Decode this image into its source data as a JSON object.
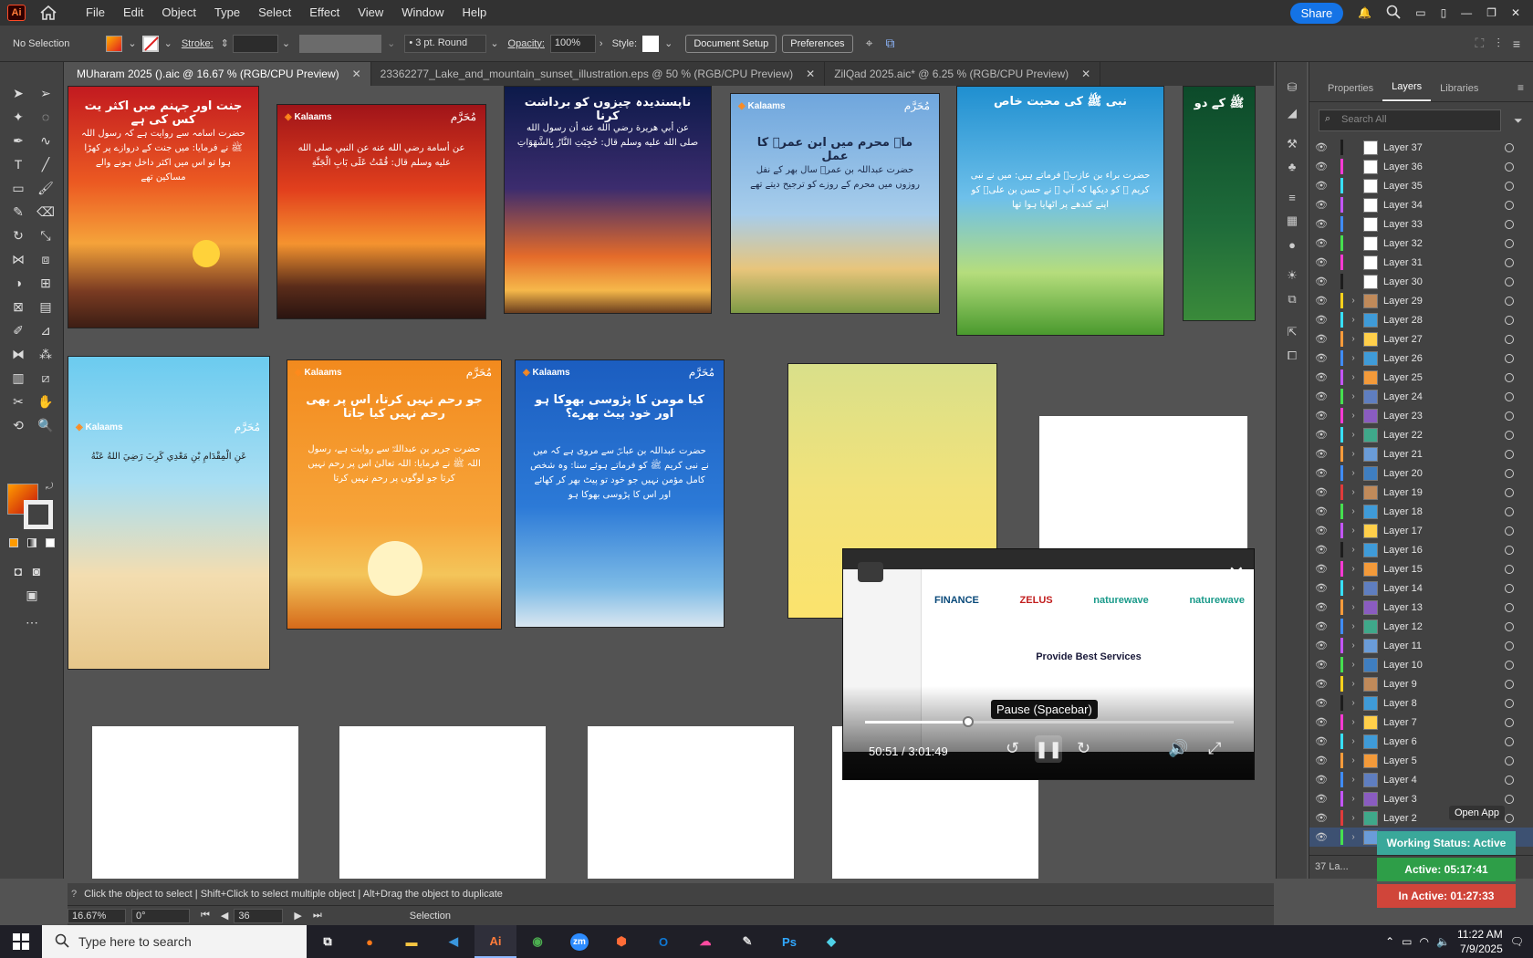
{
  "app": {
    "logo": "Ai",
    "menu": [
      "File",
      "Edit",
      "Object",
      "Type",
      "Select",
      "Effect",
      "View",
      "Window",
      "Help"
    ],
    "share_label": "Share"
  },
  "controlbar": {
    "selection": "No Selection",
    "stroke_label": "Stroke:",
    "brush": "3 pt. Round",
    "opacity_label": "Opacity:",
    "opacity_value": "100%",
    "style_label": "Style:",
    "document_setup": "Document Setup",
    "preferences": "Preferences"
  },
  "tabs": [
    {
      "label": "MUharam 2025 ().aic @ 16.67 % (RGB/CPU Preview)"
    },
    {
      "label": "23362277_Lake_and_mountain_sunset_illustration.eps @ 50 % (RGB/CPU Preview)"
    },
    {
      "label": "ZilQad 2025.aic* @ 6.25 % (RGB/CPU Preview)"
    }
  ],
  "artboards": {
    "a1_title": "جنت اور جہنم میں اکثر یت کس کی ہے",
    "a1_body": "حضرت اسامہ سے روایت ہے کہ رسول اللہ ﷺ نے فرمایا: میں جنت کے دروازے پر کھڑا ہوا تو اس میں اکثر داخل ہونے والے مساکین تھے",
    "a2_body": "عن أسامة رضي الله عنه عن النبي صلى الله عليه وسلم قال: قُمْتُ عَلَى بَابِ الْجَنَّةِ",
    "a3_title": "ناپسندیدہ چیزوں کو برداشت کرنا",
    "a3_body": "عن أبي هريرة رضي الله عنه أن رسول الله صلى الله عليه وسلم قال: حُجِبَتِ النَّارُ بِالشَّهَوَاتِ",
    "a4_title": "ماہ محرم میں ابن عمرؓ کا عمل",
    "a4_body": "حضرت عبداللہ بن عمرؓ سال بھر کے نفل روزوں میں محرم کے روزے کو ترجیح دیتے تھے",
    "a5_title": "نبی ﷺ کی محبت خاص",
    "a5_body": "حضرت براء بن عازبؓ فرماتے ہیں: میں نے نبی کریم ﷺ کو دیکھا کہ آپ ﷺ نے حسن بن علیؓ کو اپنے کندھے پر اٹھایا ہوا تھا",
    "a6_title": "ﷺ کے دو",
    "a8_title": "جو رحم نہیں کرتا، اس پر بھی رحم نہیں کیا جاتا",
    "a8_body": "حضرت جریر بن عبداللہؓ سے روایت ہے، رسول اللہ ﷺ نے فرمایا: اللہ تعالیٰ اس پر رحم نہیں کرتا جو لوگوں پر رحم نہیں کرتا",
    "a9_title": "کیا مومن کا پڑوسی بھوکا ہو اور خود پیٹ بھرے؟",
    "a9_body": "حضرت عبداللہ بن عباسؓ سے مروی ہے کہ میں نے نبی کریم ﷺ کو فرماتے ہوئے سنا: وہ شخص کامل مؤمن نہیں جو خود تو پیٹ بھر کر کھائے اور اس کا پڑوسی بھوکا ہو",
    "a7_body": "عَنِ الْمِقْدَامِ بْنِ مَعْدِي كَرِبَ رَضِيَ اللهُ عَنْهُ",
    "brand": "Kalaams",
    "muharram": "مُحَرَّم"
  },
  "video": {
    "tooltip": "Pause (Spacebar)",
    "time": "50:51 / 3:01:49",
    "progress": 0.28,
    "brands": [
      "FINANCE",
      "ZELUS",
      "naturewave",
      "naturewave"
    ],
    "headline": "Provide Best Services"
  },
  "panel": {
    "tabs": [
      "Properties",
      "Layers",
      "Libraries"
    ],
    "search_placeholder": "Search All",
    "layers": [
      "Layer 37",
      "Layer 36",
      "Layer 35",
      "Layer 34",
      "Layer 33",
      "Layer 32",
      "Layer 31",
      "Layer 30",
      "Layer 29",
      "Layer 28",
      "Layer 27",
      "Layer 26",
      "Layer 25",
      "Layer 24",
      "Layer 23",
      "Layer 22",
      "Layer 21",
      "Layer 20",
      "Layer 19",
      "Layer 18",
      "Layer 17",
      "Layer 16",
      "Layer 15",
      "Layer 14",
      "Layer 13",
      "Layer 12",
      "Layer 11",
      "Layer 10",
      "Layer 9",
      "Layer 8",
      "Layer 7",
      "Layer 6",
      "Layer 5",
      "Layer 4",
      "Layer 3",
      "Layer 2",
      "Layer 1"
    ],
    "layer_colors": [
      "#1d1d1d",
      "#ff3ad4",
      "#37e0ff",
      "#c455ff",
      "#3f8cff",
      "#46e04f",
      "#ff3ad4",
      "#1d1d1d",
      "#ffd11c",
      "#37e0ff",
      "#ff9b3a",
      "#3f8cff",
      "#c455ff",
      "#46e04f",
      "#ff3ad4",
      "#37e0ff",
      "#ff9b3a",
      "#3f8cff",
      "#e03b3b",
      "#46e04f",
      "#c455ff",
      "#1d1d1d",
      "#ff3ad4",
      "#37e0ff",
      "#ff9b3a",
      "#3f8cff",
      "#c455ff",
      "#46e04f",
      "#ffd11c",
      "#1d1d1d",
      "#ff3ad4",
      "#37e0ff",
      "#ff9b3a",
      "#3f8cff",
      "#c455ff",
      "#e03b3b",
      "#46e04f"
    ],
    "footer": "37 La..."
  },
  "status_widget": {
    "open_app": "Open App",
    "working": "Working Status: Active",
    "active": "Active: 05:17:41",
    "inactive": "In Active: 01:27:33",
    "colors": {
      "working": "#3aa89a",
      "active": "#2e9e48",
      "inactive": "#d0453a"
    }
  },
  "statusbar": {
    "hint": "Click the object to select  |  Shift+Click to select multiple object  |  Alt+Drag the object to duplicate",
    "zoom": "16.67%",
    "rotation": "0°",
    "artboard_num": "36",
    "mode": "Selection"
  },
  "taskbar": {
    "search_placeholder": "Type here to search",
    "apps": [
      "Firefox",
      "Files",
      "VS Code",
      "Illustrator",
      "Chrome",
      "Zoom",
      "Postman",
      "Outlook",
      "Creative Cloud",
      "Pen",
      "Photoshop",
      "App"
    ],
    "time": "11:22 AM",
    "date": "7/9/2025"
  }
}
